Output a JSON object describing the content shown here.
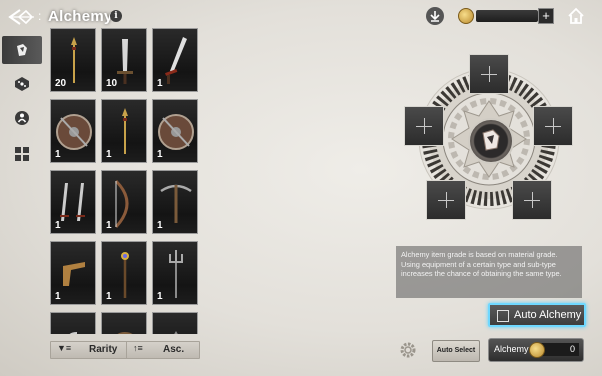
{
  "header": {
    "title": "Alchemy",
    "info_icon": "info-icon",
    "currency_plus": "+"
  },
  "tabs": [
    {
      "icon": "equipment-icon",
      "active": true
    },
    {
      "icon": "dice-icon",
      "active": false
    },
    {
      "icon": "figure-icon",
      "active": false
    },
    {
      "icon": "pieces-icon",
      "active": false
    }
  ],
  "inventory": [
    {
      "item": "spear",
      "qty": "20"
    },
    {
      "item": "greatsword",
      "qty": "10"
    },
    {
      "item": "longsword",
      "qty": "1"
    },
    {
      "item": "shield",
      "qty": "1"
    },
    {
      "item": "spear",
      "qty": "1"
    },
    {
      "item": "shield",
      "qty": "1"
    },
    {
      "item": "dual-daggers",
      "qty": "1"
    },
    {
      "item": "bow",
      "qty": "1"
    },
    {
      "item": "crossbow",
      "qty": "1"
    },
    {
      "item": "pistol",
      "qty": "1"
    },
    {
      "item": "staff",
      "qty": "1"
    },
    {
      "item": "trident",
      "qty": "1"
    },
    {
      "item": "hook",
      "qty": ""
    },
    {
      "item": "gauntlet",
      "qty": ""
    },
    {
      "item": "unknown",
      "qty": ""
    }
  ],
  "sort": {
    "rarity_label": "Rarity",
    "asc_label": "Asc."
  },
  "alchemy": {
    "info_text": "Alchemy item grade is based on material grade. Using equipment of a certain type and sub-type increases the chance of obtaining the same type.",
    "auto_alchemy_label": "Auto Alchemy",
    "auto_alchemy_checked": false,
    "auto_select_label": "Auto Select",
    "alchemy_button_label": "Alchemy",
    "alchemy_cost": "0",
    "slot_plus": "+"
  },
  "colors": {
    "highlight": "#6fd8ff",
    "card_border": "#9b9b9b"
  }
}
